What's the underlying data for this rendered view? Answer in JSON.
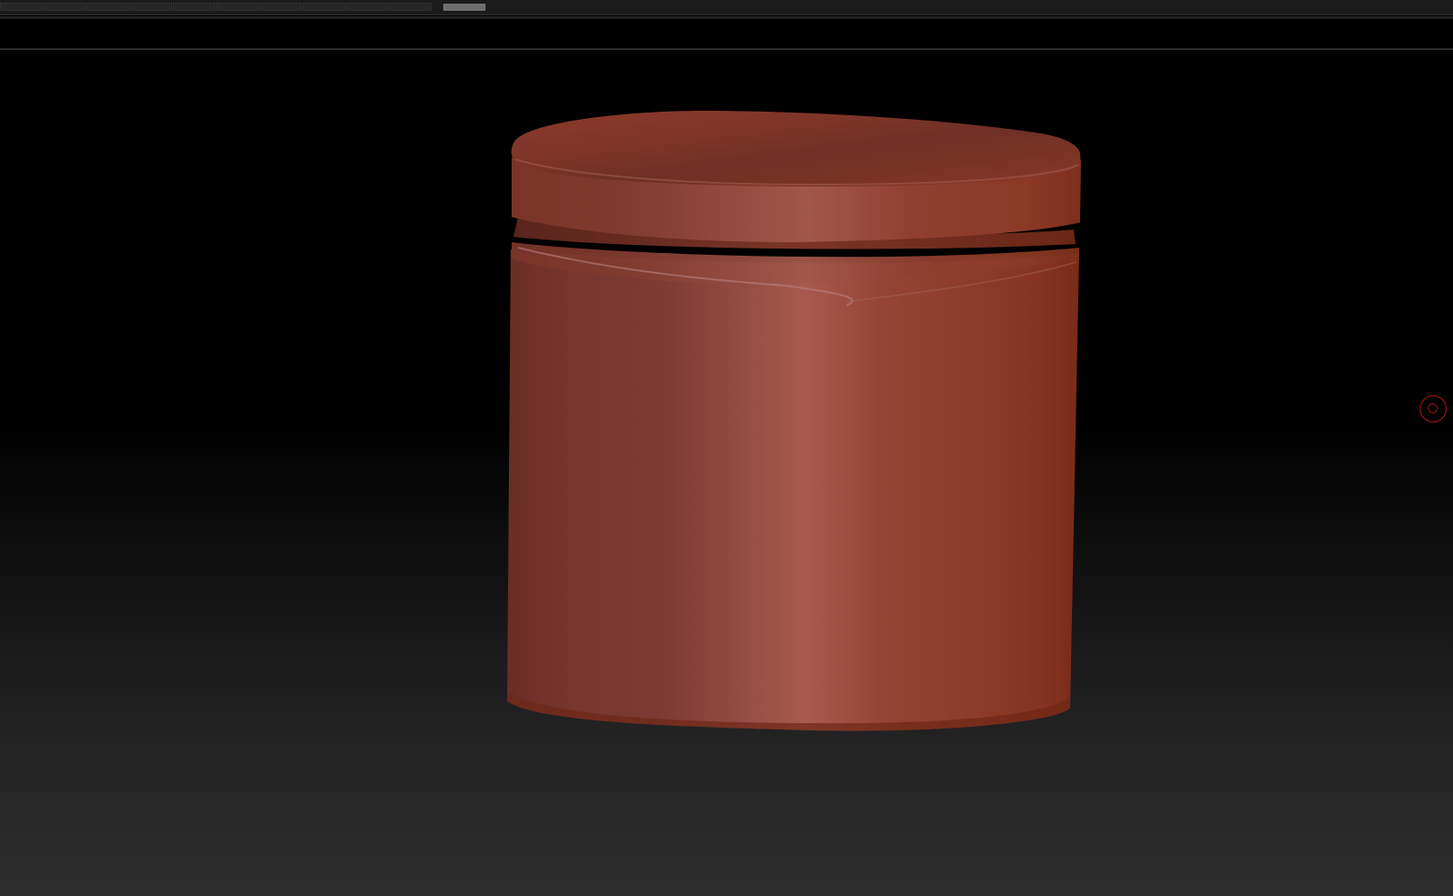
{
  "window": {
    "title": ""
  },
  "toolbar": {
    "tab_count": 10
  },
  "viewport": {
    "background_top": "#000000",
    "background_bottom": "#2e2e2e",
    "model_color": "#8e3d2a",
    "model_highlight": "#a85a4c",
    "model_shadow": "#6a2e25"
  },
  "icons": {
    "gyro": "target-circle-icon"
  }
}
